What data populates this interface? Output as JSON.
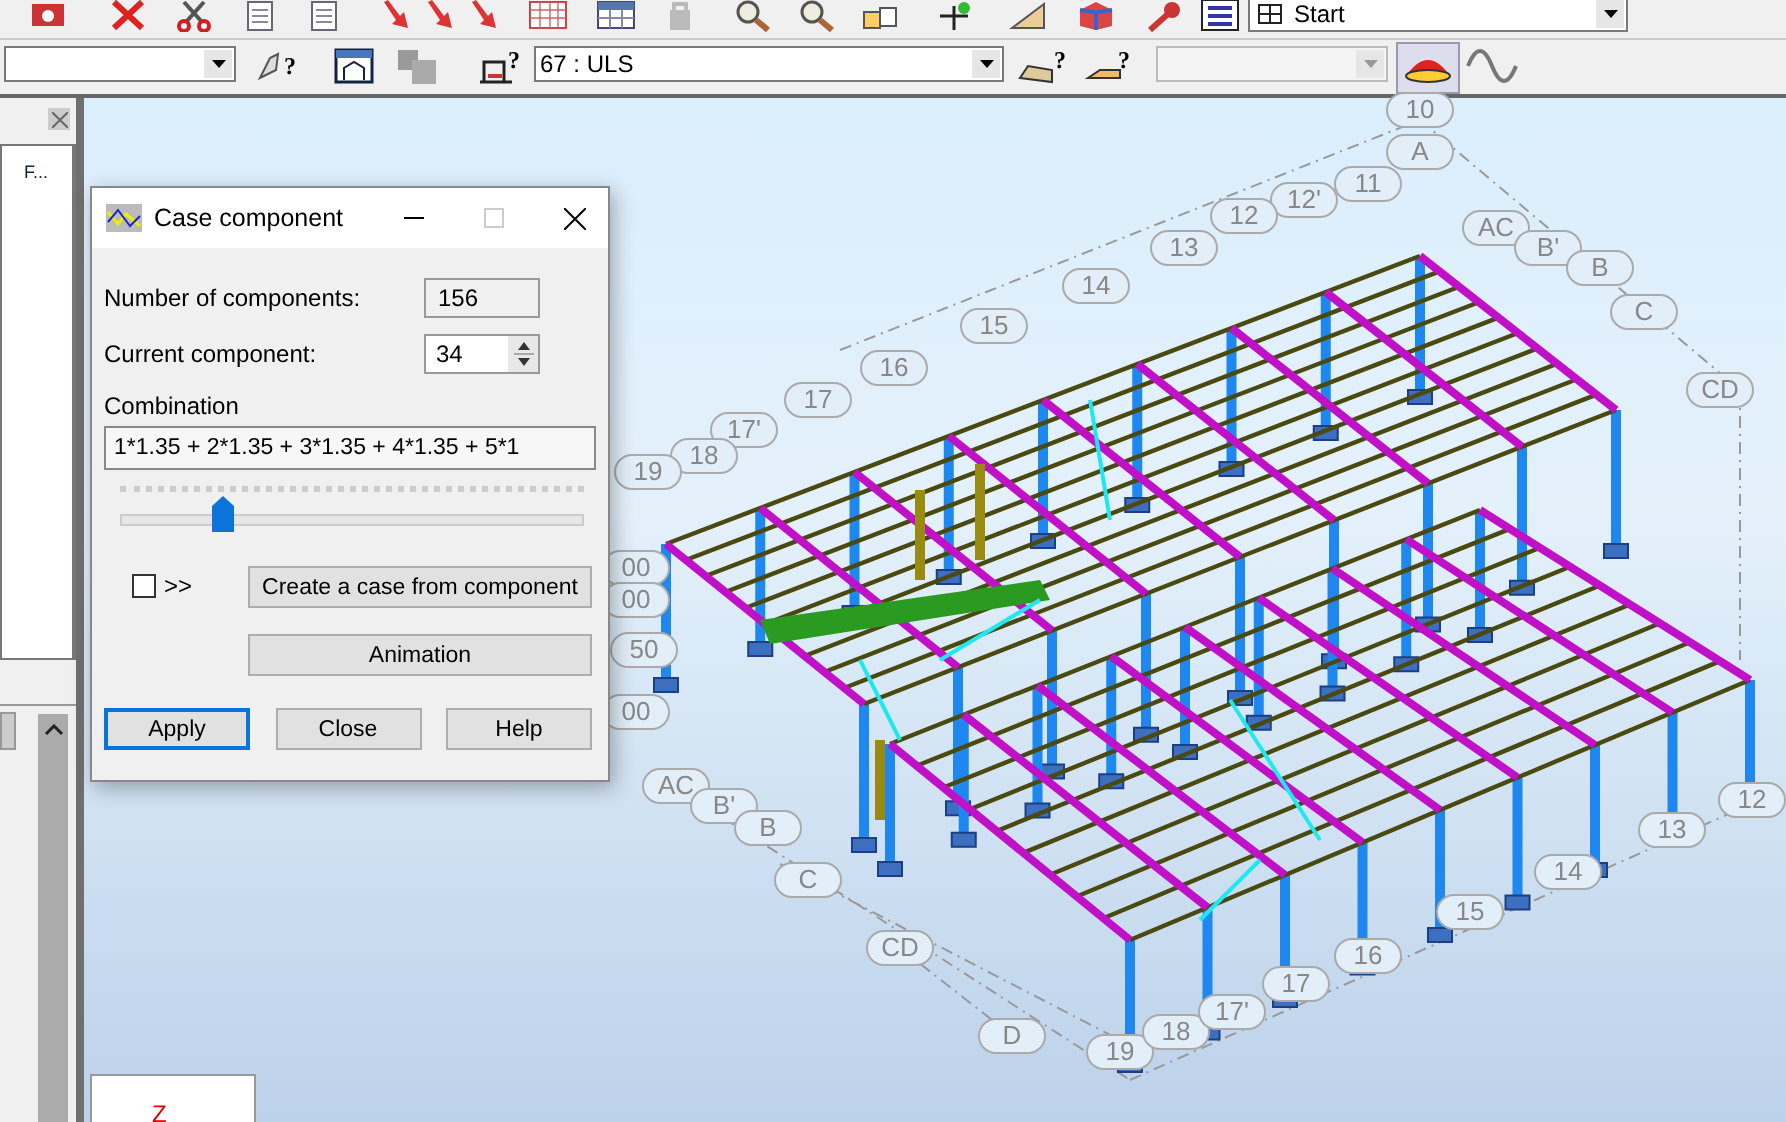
{
  "toolbar": {
    "layout_combo": "Start",
    "case_combo": "67 : ULS",
    "icon_marks": [
      "?",
      "?",
      "?",
      "?"
    ]
  },
  "left_panel": {
    "column_header": "F..."
  },
  "dialog": {
    "title": "Case component",
    "fields": [
      {
        "label": "Number of components:",
        "value": "156",
        "kind": "readonly"
      },
      {
        "label": "Current component:",
        "value": "34",
        "kind": "spin"
      }
    ],
    "combination": {
      "label": "Combination",
      "value": "1*1.35 + 2*1.35 + 3*1.35 + 4*1.35 + 5*1"
    },
    "slider": {
      "level": 0.22
    },
    "checkbox": {
      "label": ">>",
      "checked": false
    },
    "buttons": [
      {
        "label": "Create a case from component",
        "kind": "wide"
      },
      {
        "label": "Animation",
        "kind": "wide"
      },
      {
        "label": "Apply",
        "kind": "default"
      },
      {
        "label": "Close",
        "kind": "normal"
      },
      {
        "label": "Help",
        "kind": "normal"
      }
    ]
  },
  "view": {
    "grid_labels": [
      "10",
      "A",
      "12'",
      "11",
      "12",
      "13",
      "14",
      "15",
      "16",
      "17",
      "17'",
      "18",
      "19",
      "AC",
      "B'",
      "B",
      "C",
      "CD",
      "00",
      "00",
      "50",
      "00",
      "AC",
      "B'",
      "B",
      "C",
      "CD",
      "D",
      "19",
      "18",
      "17'",
      "17",
      "16",
      "15",
      "14",
      "13",
      "12"
    ],
    "axis_label": "Z"
  }
}
